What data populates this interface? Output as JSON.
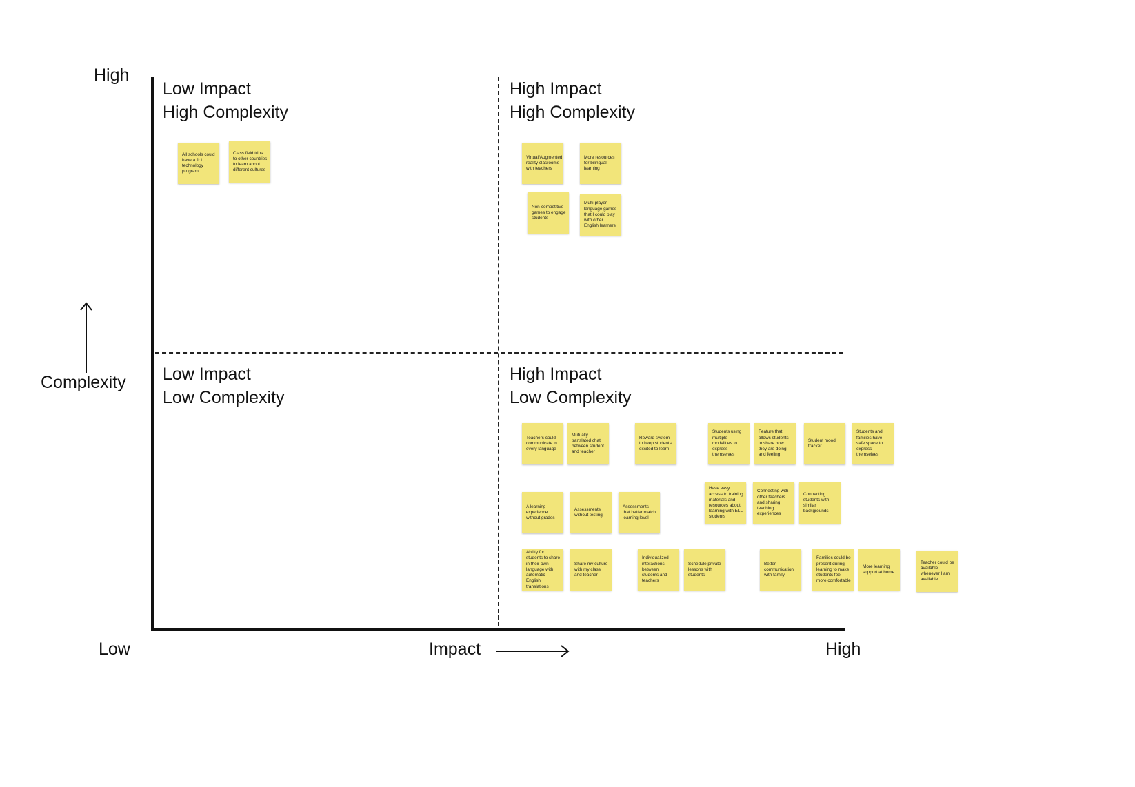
{
  "axes": {
    "y_high": "High",
    "y_label": "Complexity",
    "x_low": "Low",
    "x_label": "Impact",
    "x_high": "High"
  },
  "quadrants": {
    "top_left": {
      "line1": "Low Impact",
      "line2": "High Complexity"
    },
    "top_right": {
      "line1": "High Impact",
      "line2": "High Complexity"
    },
    "bottom_left": {
      "line1": "Low Impact",
      "line2": "Low Complexity"
    },
    "bottom_right": {
      "line1": "High Impact",
      "line2": "Low Complexity"
    }
  },
  "note_color": "#f2e57a",
  "notes": [
    "All schools could have a 1:1 technology program",
    "Class field trips to other countries to learn about different cultures",
    "Virtual/Augmented reality clasrooms with teachers",
    "More resources for bilingual learning",
    "Non-competitive games to engage students",
    "Multi-player language games that I could play with other English learners",
    "Teachers could communicate in every language",
    "Mutually translated chat between student and teacher",
    "Reward system to keep students excited to learn",
    "Students using multiple modalities to express themselves",
    "Feature that allows students to share how they are doing and feeling",
    "Student mood tracker",
    "Students and families have safe space to express themselves",
    "A learning experience without grades",
    "Assessments without testing",
    "Assessments that better match learning level",
    "Have easy access to training materials and resources about learning with ELL students",
    "Connecting with other teachers and sharing teaching experiences",
    "Connecting students with similar backgrounds",
    "Ability for students to share in their own language with automatic English translations",
    "Share my culture with my class and teacher",
    "Individualized interactions between students and teachers",
    "Schedule private lessons with students",
    "Better communication with family",
    "Families could be present during learning to make students feel more comfortable",
    "More learning support at home",
    "Teacher could be available whenever I am available"
  ]
}
